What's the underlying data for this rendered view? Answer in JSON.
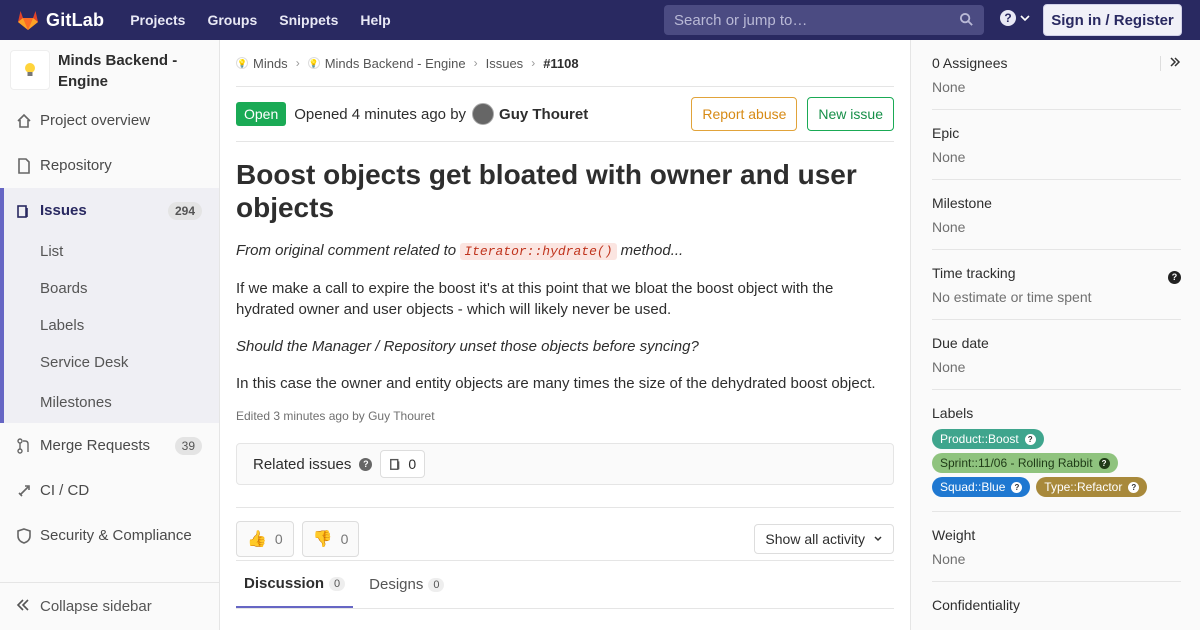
{
  "navbar": {
    "brand": "GitLab",
    "links": [
      "Projects",
      "Groups",
      "Snippets",
      "Help"
    ],
    "search_placeholder": "Search or jump to…",
    "signin": "Sign in / Register"
  },
  "sidebar": {
    "project_name": "Minds Backend - Engine",
    "items": [
      {
        "label": "Project overview"
      },
      {
        "label": "Repository"
      }
    ],
    "issues": {
      "label": "Issues",
      "count": "294"
    },
    "issue_sub": [
      "List",
      "Boards",
      "Labels",
      "Service Desk",
      "Milestones"
    ],
    "merge_requests": {
      "label": "Merge Requests",
      "count": "39"
    },
    "cicd": "CI / CD",
    "security": "Security & Compliance",
    "collapse": "Collapse sidebar"
  },
  "breadcrumb": {
    "group": "Minds",
    "project": "Minds Backend - Engine",
    "section": "Issues",
    "current": "#1108"
  },
  "issue": {
    "status": "Open",
    "opened": "Opened 4 minutes ago by",
    "author": "Guy Thouret",
    "report_abuse": "Report abuse",
    "new_issue": "New issue",
    "title": "Boost objects get bloated with owner and user objects",
    "desc_1_pre": "From original comment related to",
    "desc_1_code": "Iterator::hydrate()",
    "desc_1_post": "method...",
    "desc_2": "If we make a call to expire the boost it's at this point that we bloat the boost object with the hydrated owner and user objects - which will likely never be used.",
    "desc_3": "Should the Manager / Repository unset those objects before syncing?",
    "desc_4": "In this case the owner and entity objects are many times the size of the dehydrated boost object.",
    "edited": "Edited 3 minutes ago by Guy Thouret",
    "related_label": "Related issues",
    "related_count": "0",
    "thumbs_up": "0",
    "thumbs_down": "0",
    "activity": "Show all activity",
    "tabs": [
      {
        "label": "Discussion",
        "count": "0"
      },
      {
        "label": "Designs",
        "count": "0"
      }
    ]
  },
  "rightbar": {
    "assignees_title": "0 Assignees",
    "assignees_val": "None",
    "epic_title": "Epic",
    "epic_val": "None",
    "milestone_title": "Milestone",
    "milestone_val": "None",
    "time_title": "Time tracking",
    "time_val": "No estimate or time spent",
    "due_title": "Due date",
    "due_val": "None",
    "labels_title": "Labels",
    "labels": [
      {
        "text": "Product::Boost",
        "color": "#3fa58d"
      },
      {
        "text": "Sprint::11/06 - Rolling Rabbit",
        "color": "#8fc37e"
      },
      {
        "text": "Squad::Blue",
        "color": "#1f78d1"
      },
      {
        "text": "Type::Refactor",
        "color": "#a8893b"
      }
    ],
    "weight_title": "Weight",
    "weight_val": "None",
    "confidentiality_title": "Confidentiality"
  }
}
